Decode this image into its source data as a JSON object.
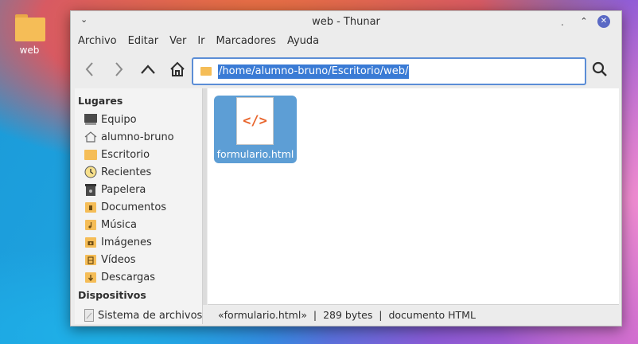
{
  "desktop": {
    "icon_label": "web"
  },
  "window": {
    "title": "web - Thunar",
    "title_menu_glyph": "⌄",
    "controls": {
      "minimize": "˯",
      "maximize": "⌃",
      "close": "✕"
    }
  },
  "menubar": {
    "items": [
      "Archivo",
      "Editar",
      "Ver",
      "Ir",
      "Marcadores",
      "Ayuda"
    ]
  },
  "toolbar": {
    "path": "/home/alumno-bruno/Escritorio/web/"
  },
  "sidebar": {
    "places_heading": "Lugares",
    "places": [
      {
        "label": "Equipo",
        "icon": "computer-icon"
      },
      {
        "label": "alumno-bruno",
        "icon": "home-icon"
      },
      {
        "label": "Escritorio",
        "icon": "desktop-folder-icon"
      },
      {
        "label": "Recientes",
        "icon": "recent-icon"
      },
      {
        "label": "Papelera",
        "icon": "trash-icon"
      },
      {
        "label": "Documentos",
        "icon": "documents-folder-icon"
      },
      {
        "label": "Música",
        "icon": "music-folder-icon"
      },
      {
        "label": "Imágenes",
        "icon": "pictures-folder-icon"
      },
      {
        "label": "Vídeos",
        "icon": "videos-folder-icon"
      },
      {
        "label": "Descargas",
        "icon": "downloads-folder-icon"
      }
    ],
    "devices_heading": "Dispositivos",
    "devices": [
      {
        "label": "Sistema de archivos",
        "icon": "drive-icon"
      }
    ]
  },
  "files": [
    {
      "name": "formulario.html",
      "glyph": "</>",
      "icon": "html-file-icon",
      "selected": true
    }
  ],
  "statusbar": {
    "text": "«formulario.html»  |  289 bytes  |  documento HTML"
  },
  "colors": {
    "accent": "#3a7bd5",
    "selection": "#5d9ed5",
    "folder": "#f5bd57",
    "html_glyph": "#e8642b",
    "close_button": "#5a69c4"
  }
}
